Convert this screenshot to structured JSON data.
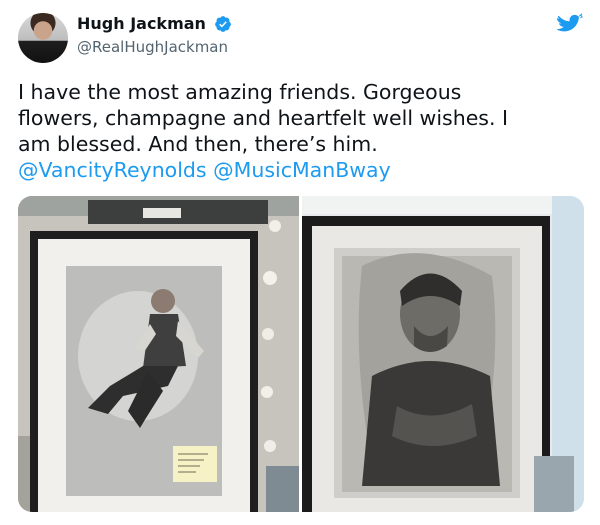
{
  "tweet": {
    "author_name": "Hugh Jackman",
    "author_handle": "@RealHughJackman",
    "text_line1": "I have the most amazing friends. Gorgeous",
    "text_line2": "flowers, champagne and heartfelt well wishes. I",
    "text_line3": "am blessed. And then, there’s him.",
    "mention1": "@VancityReynolds",
    "mention2": "@MusicManBway",
    "photos": [
      "left-photo",
      "right-photo"
    ]
  },
  "colors": {
    "accent": "#1d9bf0",
    "text": "#0f1419",
    "secondary_text": "#536471"
  },
  "icons": [
    "verified-badge-icon",
    "twitter-bird-icon"
  ]
}
